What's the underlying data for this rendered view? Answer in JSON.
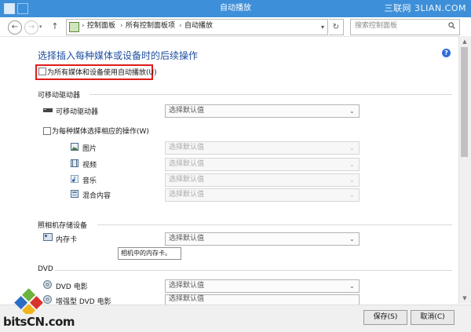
{
  "window": {
    "title": "自动播放",
    "watermark": "三联网 3LIAN.COM"
  },
  "nav": {
    "back_icon": "back-arrow-icon",
    "forward_icon": "forward-arrow-icon",
    "up_icon": "up-arrow-icon",
    "breadcrumb": [
      "控制面板",
      "所有控制面板项",
      "自动播放"
    ],
    "refresh_icon": "refresh-icon",
    "search_placeholder": "搜索控制面板"
  },
  "page": {
    "heading": "选择插入每种媒体或设备时的后续操作",
    "use_autoplay_label": "为所有媒体和设备使用自动播放(U)",
    "use_autoplay_checked": false
  },
  "removable": {
    "section_title": "可移动驱动器",
    "drive_label": "可移动驱动器",
    "drive_value": "选择默认值",
    "per_media_label": "为每种媒体选择相应的操作(W)",
    "per_media_checked": false,
    "media": [
      {
        "label": "图片",
        "value": "选择默认值",
        "icon": "picture-icon"
      },
      {
        "label": "视频",
        "value": "选择默认值",
        "icon": "video-icon"
      },
      {
        "label": "音乐",
        "value": "选择默认值",
        "icon": "music-icon"
      },
      {
        "label": "混合内容",
        "value": "选择默认值",
        "icon": "mixed-content-icon"
      }
    ]
  },
  "camera": {
    "section_title": "照相机存储设备",
    "card_label": "内存卡",
    "card_value": "选择默认值",
    "tooltip": "相机中的内存卡。"
  },
  "dvd": {
    "section_title": "DVD",
    "items": [
      {
        "label": "DVD 电影",
        "value": "选择默认值"
      },
      {
        "label": "增强型 DVD 电影",
        "value": "选择默认值"
      }
    ]
  },
  "footer": {
    "save_label": "保存(S)",
    "cancel_label": "取消(C)"
  },
  "logo": {
    "text": "bitsCN.com"
  },
  "colors": {
    "titlebar": "#3e8fd9",
    "heading": "#1e4fa0",
    "highlight": "#e01b1b"
  }
}
